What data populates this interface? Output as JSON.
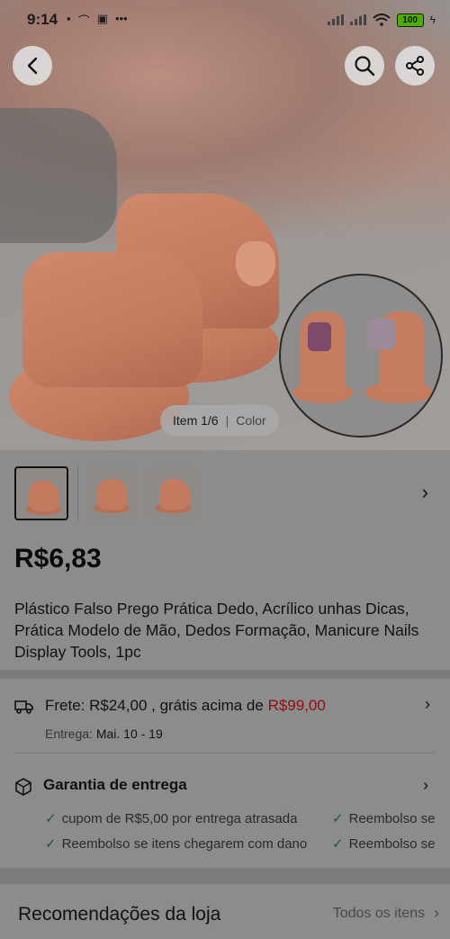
{
  "status_bar": {
    "time": "9:14",
    "battery": "100"
  },
  "gallery": {
    "item_label": "Item 1/6",
    "separator": "|",
    "color_label": "Color"
  },
  "product": {
    "price": "R$6,83",
    "title": "Plástico Falso Prego Prática Dedo, Acrílico unhas Dicas, Prática Modelo de Mão, Dedos Formação, Manicure Nails Display Tools, 1pc"
  },
  "shipping": {
    "prefix": "Frete: R$24,00 , grátis acima de ",
    "threshold": "R$99,00",
    "delivery_label": "Entrega: ",
    "delivery_dates": "Mai. 10 - 19"
  },
  "guarantee": {
    "title": "Garantia de entrega",
    "benefits": [
      "cupom de R$5,00 por entrega atrasada",
      "Reembolso se",
      "Reembolso se itens chegarem com dano",
      "Reembolso se"
    ]
  },
  "recommendations": {
    "title": "Recomendações da loja",
    "all_items": "Todos os itens"
  },
  "colors": {
    "price_red": "#8b0f12",
    "check_green": "#1d5c33"
  }
}
